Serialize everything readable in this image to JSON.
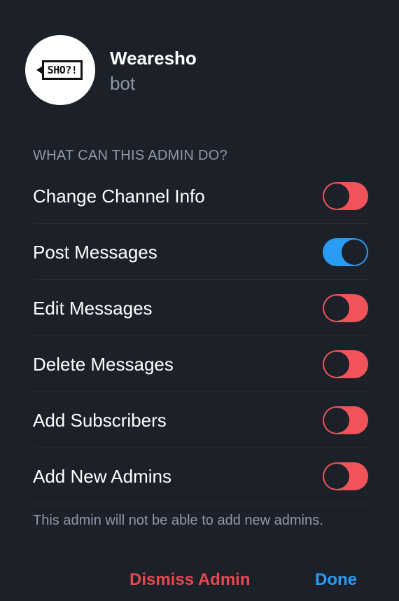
{
  "bot": {
    "name": "Wearesho",
    "subtitle": "bot",
    "logo_text": "SHO?!"
  },
  "section_header": "WHAT CAN THIS ADMIN DO?",
  "permissions": [
    {
      "label": "Change Channel Info",
      "enabled": false
    },
    {
      "label": "Post Messages",
      "enabled": true
    },
    {
      "label": "Edit Messages",
      "enabled": false
    },
    {
      "label": "Delete Messages",
      "enabled": false
    },
    {
      "label": "Add Subscribers",
      "enabled": false
    },
    {
      "label": "Add New Admins",
      "enabled": false
    }
  ],
  "footnote": "This admin will not be able to add new admins.",
  "actions": {
    "dismiss_label": "Dismiss Admin",
    "done_label": "Done"
  },
  "colors": {
    "background": "#1b2029",
    "toggle_on": "#2a9cf3",
    "toggle_off": "#f0545a",
    "danger": "#e8474f",
    "accent": "#2a9cf3",
    "secondary_text": "#8e9aab"
  }
}
